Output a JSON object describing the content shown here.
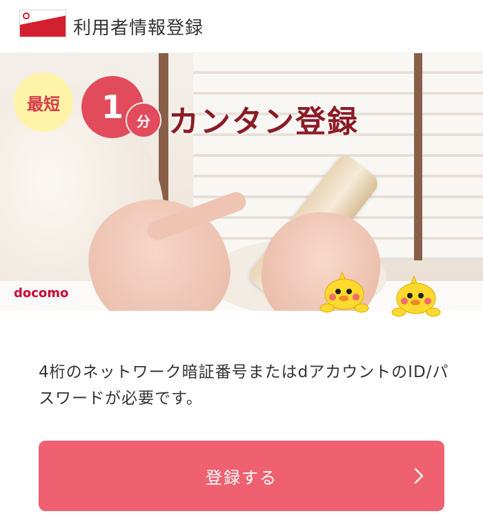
{
  "header": {
    "title": "利用者情報登録",
    "icon": "d-app-icon"
  },
  "hero": {
    "badge_saitan": "最短",
    "badge_number": "1",
    "badge_unit": "分",
    "headline": "カンタン登録",
    "brand": "docomo",
    "mascot_icon": "poinco-bird-icon",
    "brand_color": "#cc0033",
    "headline_color": "#8c1c26"
  },
  "description": "4桁のネットワーク暗証番号またはdアカウントのID/パスワードが必要です。",
  "register_button": {
    "label": "登録する",
    "icon": "chevron-right-icon",
    "color": "#ef6170"
  }
}
